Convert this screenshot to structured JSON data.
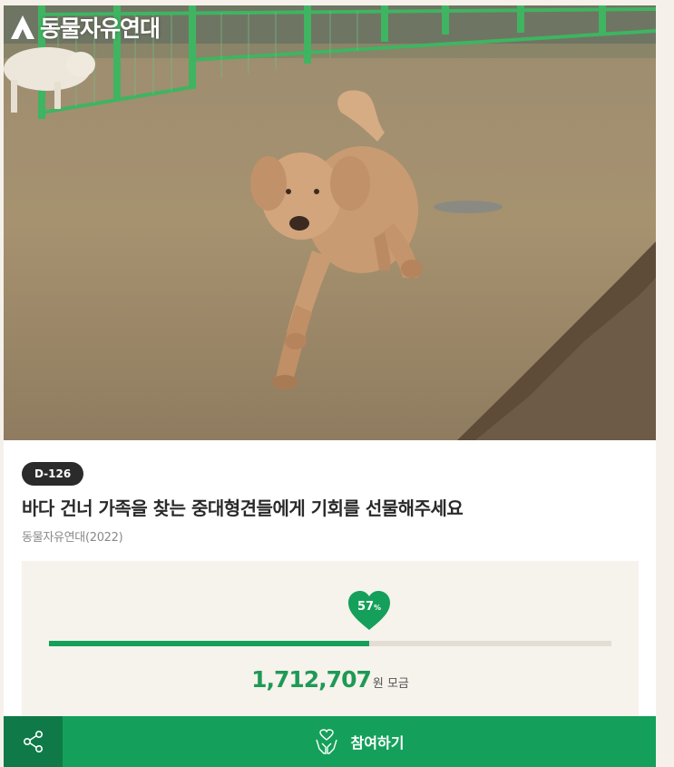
{
  "brand": {
    "name": "동물자유연대",
    "icon": "brand-logo-icon"
  },
  "campaign": {
    "dday": "D-126",
    "title": "바다 건너 가족을 찾는 중대형견들에게 기회를 선물해주세요",
    "organizer": "동물자유연대(2022)"
  },
  "progress": {
    "percent_value": 57,
    "percent_label": "57",
    "percent_sign": "%",
    "amount": "1,712,707",
    "amount_unit": "원 모금"
  },
  "actions": {
    "share_icon": "share-icon",
    "join_icon": "hands-heart-icon",
    "join_label": "참여하기"
  },
  "colors": {
    "accent": "#14a05a",
    "accent_dark": "#0f7a47",
    "badge": "#2b2b2b",
    "panel": "#f6f2ec"
  }
}
